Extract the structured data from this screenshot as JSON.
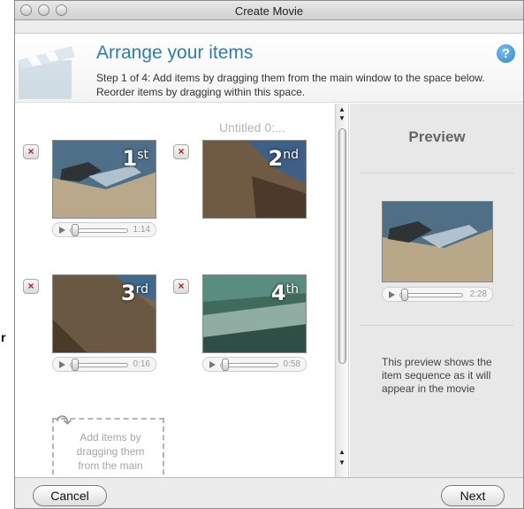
{
  "window": {
    "title": "Create Movie"
  },
  "header": {
    "title": "Arrange your items",
    "step_text": "Step 1 of 4: Add items by dragging them from the main window to the space below. Reorder items by dragging within this space.",
    "help_label": "?"
  },
  "arrange": {
    "untitled_label": "Untitled 0:...",
    "items": [
      {
        "ordinal": "1",
        "suffix": "st",
        "duration": "1:14",
        "remove": "×"
      },
      {
        "ordinal": "2",
        "suffix": "nd",
        "duration": "",
        "remove": "×"
      },
      {
        "ordinal": "3",
        "suffix": "rd",
        "duration": "0:16",
        "remove": "×"
      },
      {
        "ordinal": "4",
        "suffix": "th",
        "duration": "0:58",
        "remove": "×"
      }
    ],
    "dropzone_text": "Add items by dragging them from the main"
  },
  "preview": {
    "title": "Preview",
    "duration": "2:28",
    "note": "This preview shows the item sequence as it will appear in the movie"
  },
  "footer": {
    "cancel": "Cancel",
    "next": "Next"
  },
  "side_mark": "r",
  "icons": {
    "help": "help-icon",
    "remove": "close-icon",
    "play": "play-icon",
    "scroll_up": "arrow-up-icon",
    "scroll_down": "arrow-down-icon",
    "drop": "curved-arrow-icon"
  }
}
